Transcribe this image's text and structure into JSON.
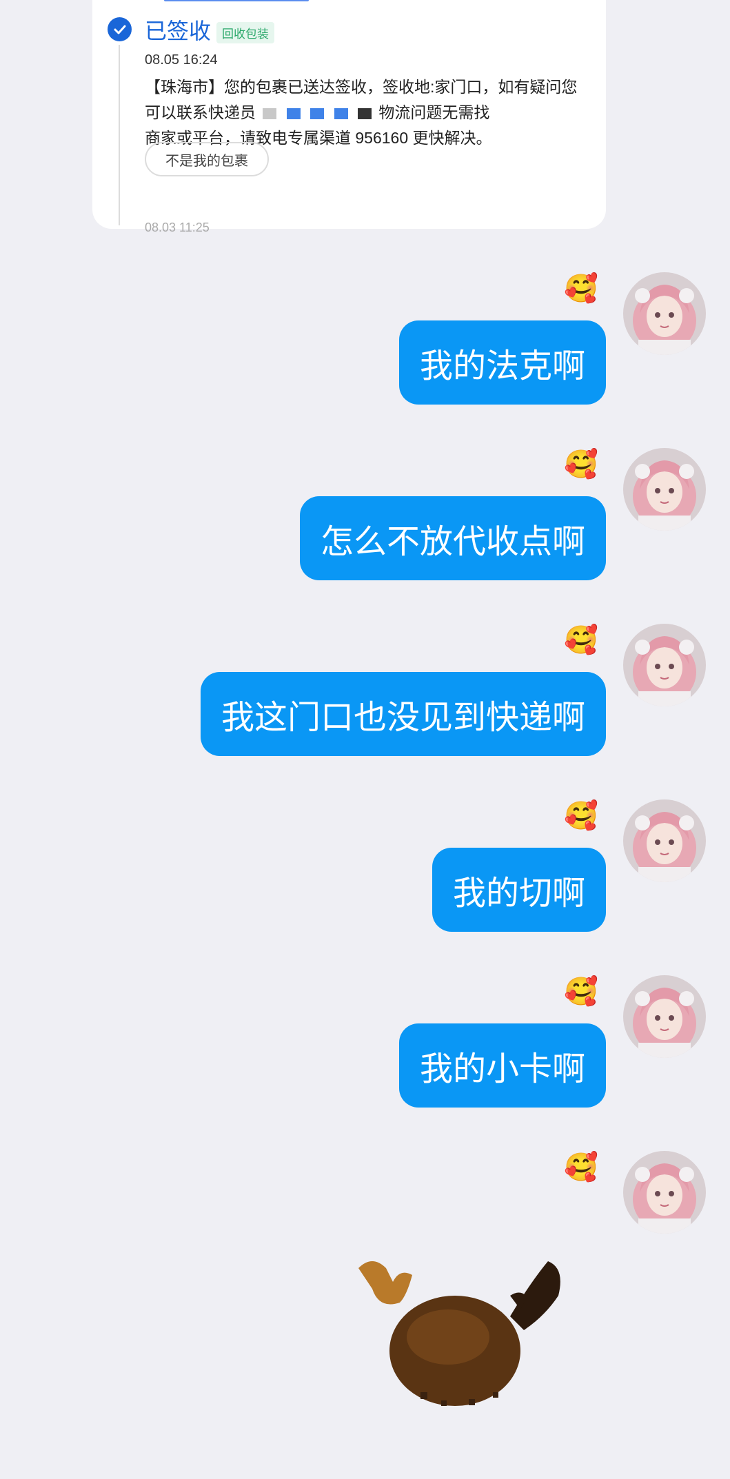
{
  "card": {
    "status_title": "已签收",
    "status_tag": "回收包装",
    "time": "08.05 16:24",
    "line1_a": "【珠海市】您的包裹已送达签收，签收地:家门口，如有疑问您",
    "line2_a": "可以联系快递员",
    "line2_b": "物流问题无需找",
    "line3": "商家或平台，请致电专属渠道 956160 更快解决。",
    "not_mine_button": "不是我的包裹",
    "next_time": "08.03 11:25"
  },
  "messages": [
    {
      "text": "我的法克啊",
      "emoji": "🥰"
    },
    {
      "text": "怎么不放代收点啊",
      "emoji": "🥰"
    },
    {
      "text": "我这门口也没见到快递啊",
      "emoji": "🥰"
    },
    {
      "text": "我的切啊",
      "emoji": "🥰"
    },
    {
      "text": "我的小卡啊",
      "emoji": "🥰"
    },
    {
      "text": "",
      "emoji": "🥰"
    }
  ],
  "colors": {
    "accent": "#1a66d8",
    "bubble": "#0a97f5",
    "background": "#efeff4"
  }
}
